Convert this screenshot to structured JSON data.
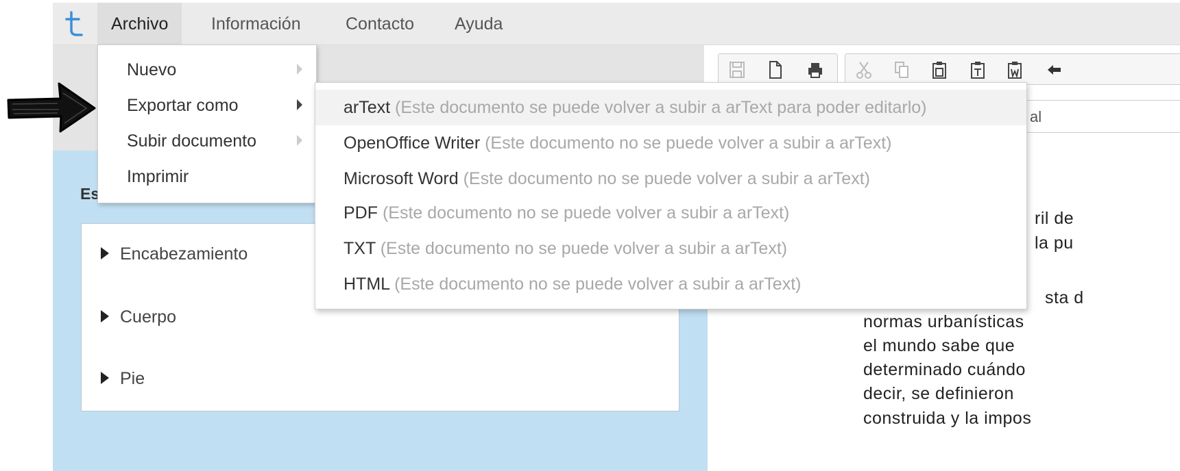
{
  "menubar": {
    "logo_letter": "t",
    "items": [
      "Archivo",
      "Información",
      "Contacto",
      "Ayuda"
    ],
    "active": "Archivo"
  },
  "archivo_menu": {
    "items": [
      {
        "label": "Nuevo",
        "has_submenu": true
      },
      {
        "label": "Exportar como",
        "has_submenu": true
      },
      {
        "label": "Subir documento",
        "has_submenu": true
      },
      {
        "label": "Imprimir",
        "has_submenu": false
      }
    ]
  },
  "export_submenu": {
    "items": [
      {
        "name": "arText",
        "note": "(Este documento se puede volver a subir a arText para poder editarlo)"
      },
      {
        "name": "OpenOffice Writer",
        "note": "(Este documento no se puede volver a subir a arText)"
      },
      {
        "name": "Microsoft Word",
        "note": "(Este documento no se puede volver a subir a arText)"
      },
      {
        "name": "PDF",
        "note": "(Este documento no se puede volver a subir a arText)"
      },
      {
        "name": "TXT",
        "note": "(Este documento no se puede volver a subir a arText)"
      },
      {
        "name": "HTML",
        "note": "(Este documento no se puede volver a subir a arText)"
      }
    ]
  },
  "left_panel": {
    "title_partial": "Es",
    "sections": [
      "Encabezamiento",
      "Cuerpo",
      "Pie"
    ]
  },
  "toolbar": {
    "icons": [
      "save-icon",
      "new-document-icon",
      "print-icon",
      "cut-icon",
      "copy-icon",
      "paste-icon",
      "paste-text-icon",
      "paste-word-icon",
      "undo-icon"
    ],
    "style_select_partial": "al"
  },
  "document": {
    "lines": [
      "ril de",
      "la pu",
      "sta d",
      "normas urbanísticas",
      "el mundo sabe que",
      "determinado cuándo",
      "decir, se definieron",
      "construida y la impos"
    ]
  },
  "colors": {
    "menubar_bg": "#ebebeb",
    "panel_bg": "#c1dff2",
    "logo": "#3b8fd9",
    "note_gray": "#a8a8a8"
  }
}
